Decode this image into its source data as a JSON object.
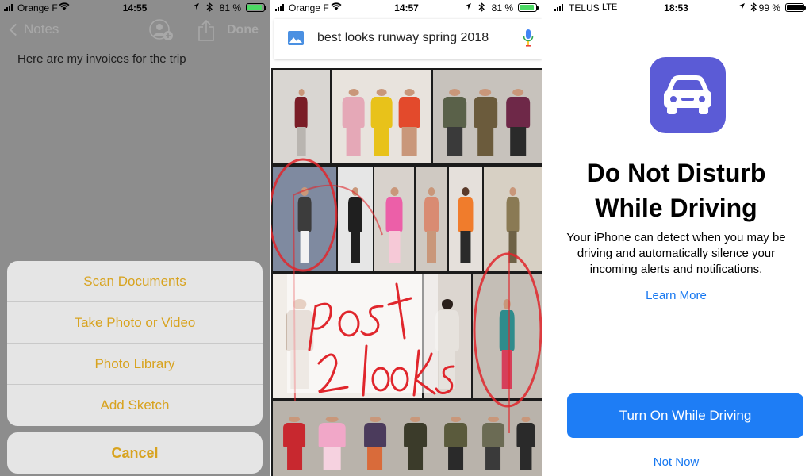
{
  "notes_panel": {
    "status": {
      "carrier": "Orange F",
      "time": "14:55",
      "battery": "81 %"
    },
    "nav": {
      "back_label": "Notes",
      "done_label": "Done"
    },
    "note_text": "Here are my invoices for the trip",
    "action_sheet": {
      "items": [
        "Scan Documents",
        "Take Photo or Video",
        "Photo Library",
        "Add Sketch"
      ],
      "cancel": "Cancel"
    },
    "colors": {
      "accent": "#d8a31f",
      "dim_background": "#8d8d8d"
    }
  },
  "search_panel": {
    "status": {
      "carrier": "Orange F",
      "time": "14:57",
      "battery": "81 %"
    },
    "search_query": "best looks runway spring 2018",
    "icons": [
      "image-search-icon",
      "microphone-icon"
    ],
    "handwritten_annotation": "Post 2 looks",
    "collage": "runway fashion photo grid"
  },
  "driving_panel": {
    "status": {
      "carrier": "TELUS",
      "network": "LTE",
      "time": "18:53",
      "battery": "99 %"
    },
    "title_line1": "Do Not Disturb",
    "title_line2": "While Driving",
    "description": "Your iPhone can detect when you may be driving and automatically silence your incoming alerts and notifications.",
    "learn_more": "Learn More",
    "primary_button": "Turn On While Driving",
    "secondary_button": "Not Now",
    "colors": {
      "brand_icon": "#5b5bd6",
      "button": "#1e7df5",
      "link": "#1677f0"
    }
  }
}
